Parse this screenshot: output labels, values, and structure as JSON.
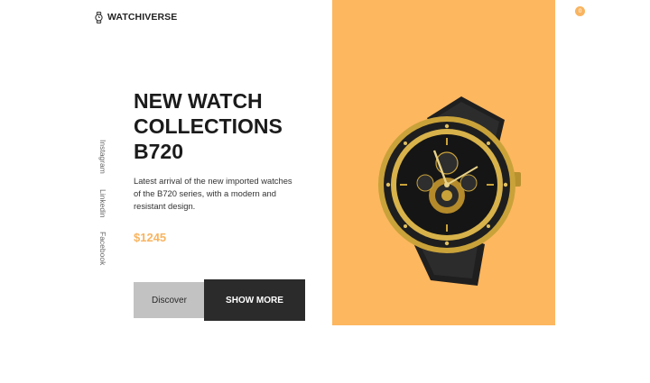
{
  "brand": {
    "name": "WATCHIVERSE",
    "icon": "watch-icon"
  },
  "nav": {
    "icons": [
      "menu-icon",
      "search-icon",
      "moon-icon",
      "shopping-bag-icon"
    ],
    "cart_count": "0"
  },
  "social": [
    "Instagram",
    "Linkedin",
    "Facebook"
  ],
  "hero": {
    "title_lines": [
      "NEW WATCH",
      "COLLECTIONS",
      "B720"
    ],
    "description": "Latest arrival of the new imported watches of the B720 series, with a modern and resistant design.",
    "price": "$1245",
    "discover_label": "Discover",
    "show_more_label": "SHOW MORE"
  },
  "colors": {
    "accent": "#fdb75f",
    "dark": "#2b2b2b",
    "muted_button": "#c2c2c2"
  }
}
